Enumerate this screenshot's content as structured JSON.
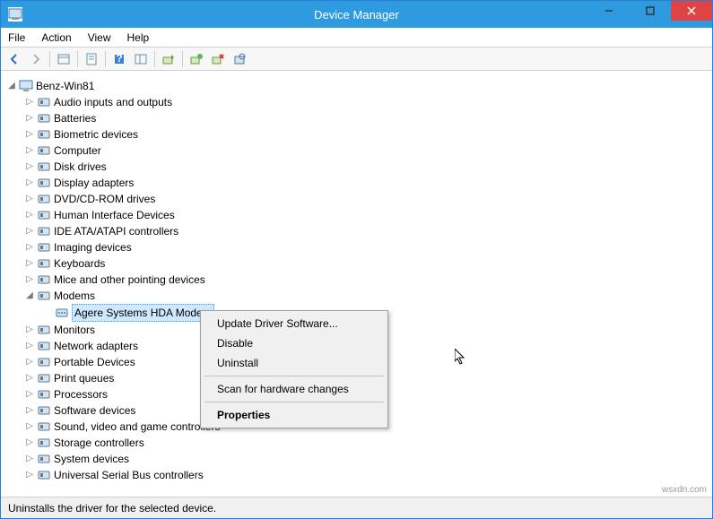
{
  "window": {
    "title": "Device Manager"
  },
  "menu": {
    "file": "File",
    "action": "Action",
    "view": "View",
    "help": "Help"
  },
  "tree": {
    "root": "Benz-Win81",
    "categories": [
      {
        "label": "Audio inputs and outputs",
        "expanded": false
      },
      {
        "label": "Batteries",
        "expanded": false
      },
      {
        "label": "Biometric devices",
        "expanded": false
      },
      {
        "label": "Computer",
        "expanded": false
      },
      {
        "label": "Disk drives",
        "expanded": false
      },
      {
        "label": "Display adapters",
        "expanded": false
      },
      {
        "label": "DVD/CD-ROM drives",
        "expanded": false
      },
      {
        "label": "Human Interface Devices",
        "expanded": false
      },
      {
        "label": "IDE ATA/ATAPI controllers",
        "expanded": false
      },
      {
        "label": "Imaging devices",
        "expanded": false
      },
      {
        "label": "Keyboards",
        "expanded": false
      },
      {
        "label": "Mice and other pointing devices",
        "expanded": false
      },
      {
        "label": "Modems",
        "expanded": true,
        "children": [
          {
            "label": "Agere Systems HDA Modem",
            "selected": true
          }
        ]
      },
      {
        "label": "Monitors",
        "expanded": false
      },
      {
        "label": "Network adapters",
        "expanded": false
      },
      {
        "label": "Portable Devices",
        "expanded": false
      },
      {
        "label": "Print queues",
        "expanded": false
      },
      {
        "label": "Processors",
        "expanded": false
      },
      {
        "label": "Software devices",
        "expanded": false
      },
      {
        "label": "Sound, video and game controllers",
        "expanded": false
      },
      {
        "label": "Storage controllers",
        "expanded": false
      },
      {
        "label": "System devices",
        "expanded": false
      },
      {
        "label": "Universal Serial Bus controllers",
        "expanded": false
      }
    ]
  },
  "context_menu": {
    "update": "Update Driver Software...",
    "disable": "Disable",
    "uninstall": "Uninstall",
    "scan": "Scan for hardware changes",
    "properties": "Properties"
  },
  "statusbar": {
    "text": "Uninstalls the driver for the selected device."
  },
  "watermark": "wsxdn.com"
}
